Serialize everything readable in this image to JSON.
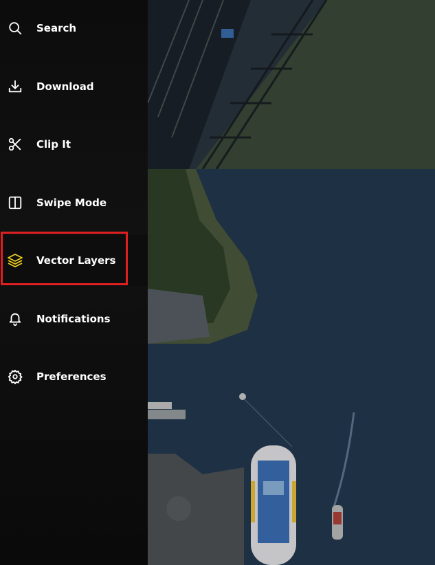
{
  "sidebar": {
    "items": [
      {
        "label": "Search",
        "icon": "search-icon",
        "active": false
      },
      {
        "label": "Download",
        "icon": "download-icon",
        "active": false
      },
      {
        "label": "Clip It",
        "icon": "scissors-icon",
        "active": false
      },
      {
        "label": "Swipe Mode",
        "icon": "swipe-mode-icon",
        "active": false
      },
      {
        "label": "Vector Layers",
        "icon": "layers-icon",
        "active": true
      },
      {
        "label": "Notifications",
        "icon": "bell-icon",
        "active": false
      },
      {
        "label": "Preferences",
        "icon": "gear-icon",
        "active": false
      }
    ]
  },
  "colors": {
    "active_icon": "#f2d21b",
    "highlight": "#e02020",
    "text": "#ffffff"
  }
}
